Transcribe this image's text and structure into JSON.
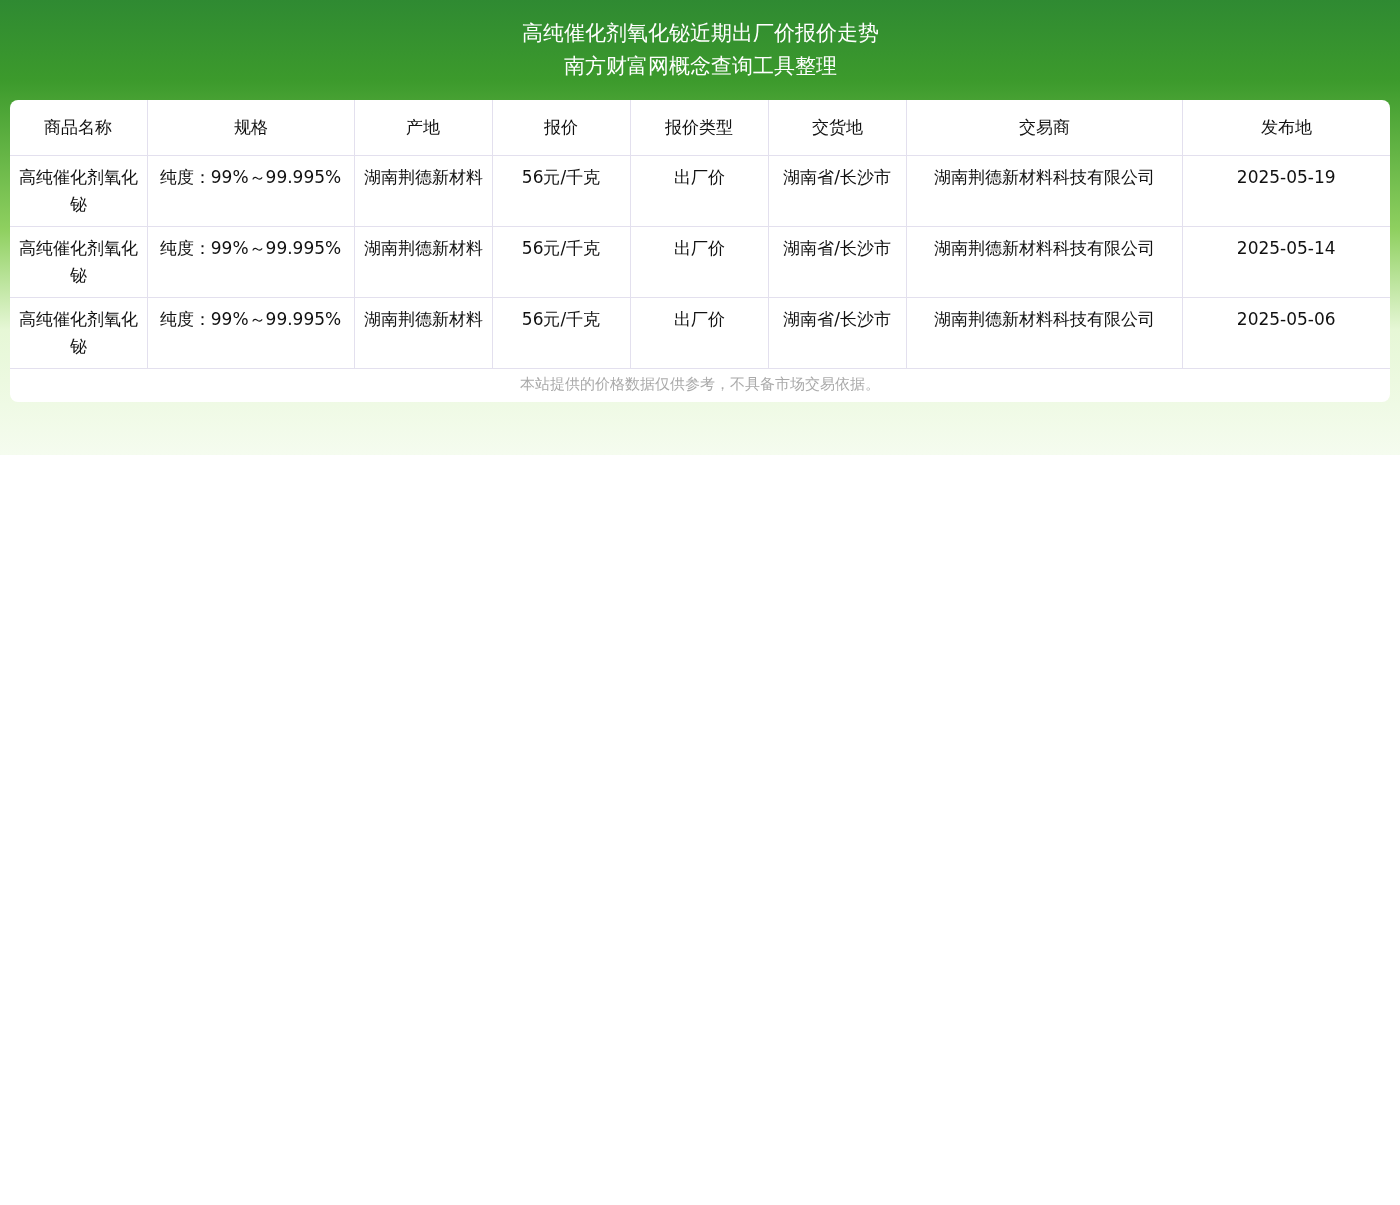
{
  "header": {
    "title": "高纯催化剂氧化铋近期出厂价报价走势",
    "subtitle": "南方财富网概念查询工具整理"
  },
  "table": {
    "columns": [
      "商品名称",
      "规格",
      "产地",
      "报价",
      "报价类型",
      "交货地",
      "交易商",
      "发布地"
    ],
    "rows": [
      [
        "高纯催化剂氧化铋",
        "纯度：99%～99.995%",
        "湖南荆德新材料",
        "56元/千克",
        "出厂价",
        "湖南省/长沙市",
        "湖南荆德新材料科技有限公司",
        "2025-05-19"
      ],
      [
        "高纯催化剂氧化铋",
        "纯度：99%～99.995%",
        "湖南荆德新材料",
        "56元/千克",
        "出厂价",
        "湖南省/长沙市",
        "湖南荆德新材料科技有限公司",
        "2025-05-14"
      ],
      [
        "高纯催化剂氧化铋",
        "纯度：99%～99.995%",
        "湖南荆德新材料",
        "56元/千克",
        "出厂价",
        "湖南省/长沙市",
        "湖南荆德新材料科技有限公司",
        "2025-05-06"
      ]
    ]
  },
  "note": "本站提供的价格数据仅供参考，不具备市场交易依据。"
}
